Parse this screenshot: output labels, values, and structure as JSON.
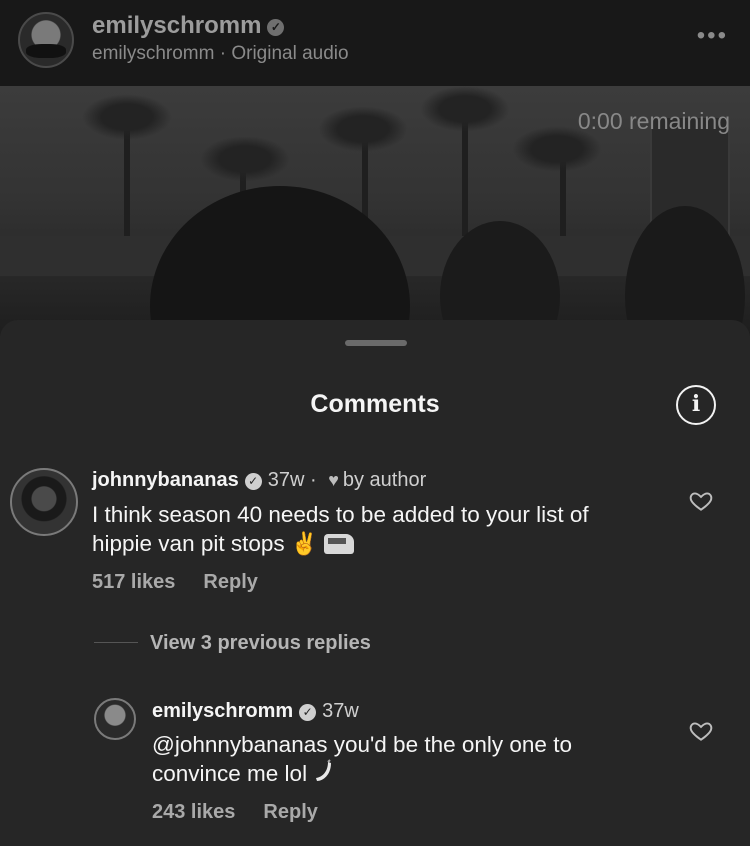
{
  "header": {
    "username": "emilyschromm",
    "verified_icon": "verified-badge-icon",
    "subtitle_user": "emilyschromm",
    "subtitle_sep": " · ",
    "audio": "Original audio",
    "more_icon": "more-horizontal-icon",
    "more_label": "•••"
  },
  "video": {
    "remaining": "0:00 remaining"
  },
  "comments_sheet": {
    "title": "Comments",
    "info_icon": "info-icon",
    "info_glyph": "i"
  },
  "comments": [
    {
      "username": "johnnybananas",
      "age": "37w",
      "dot": " · ",
      "liked_by": "by author",
      "text": "I think season 40 needs to be added to your list of hippie van pit stops",
      "emoji_peace": "✌",
      "likes": "517 likes",
      "reply_label": "Reply"
    }
  ],
  "view_replies": "View 3 previous replies",
  "reply": {
    "username": "emilyschromm",
    "age": "37w",
    "text": "@johnnybananas you'd be the only one to convince me lol",
    "likes": "243 likes",
    "reply_label": "Reply"
  },
  "colors": {
    "background": "#262626",
    "header": "#181818",
    "text": "#f5f5f5",
    "muted": "#a9a9a9"
  }
}
